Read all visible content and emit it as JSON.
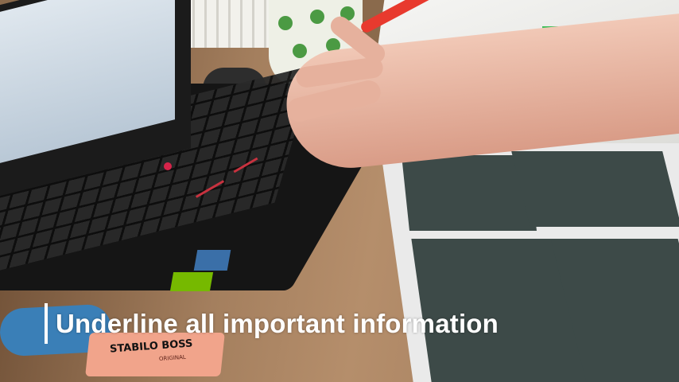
{
  "caption": {
    "text": "Underline all important information"
  },
  "objects": {
    "highlighter_brand": "STABILO BOSS",
    "highlighter_sub": "ORIGINAL",
    "pen_color": "#e83a2e",
    "highlight_color": "#3fbf5a"
  }
}
